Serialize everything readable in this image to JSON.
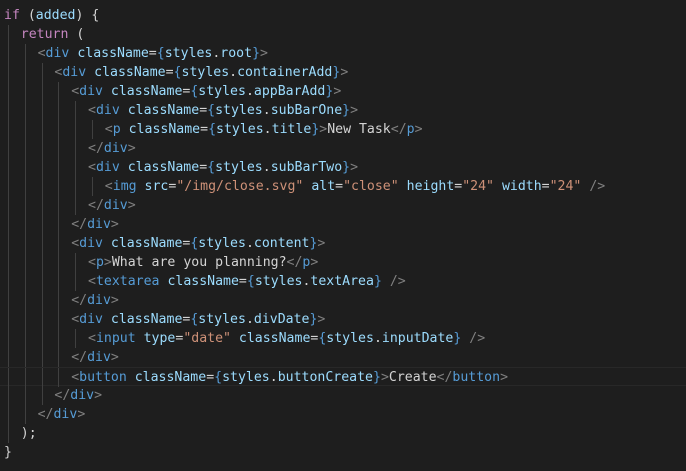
{
  "editor": {
    "language": "jsx",
    "theme": "dark",
    "cursor_line": 20,
    "lines": [
      {
        "indent": 0,
        "tokens": [
          [
            "kw",
            "if"
          ],
          [
            "punc",
            " ("
          ],
          [
            "var",
            "added"
          ],
          [
            "punc",
            ") {"
          ]
        ]
      },
      {
        "indent": 1,
        "tokens": [
          [
            "kw",
            "return"
          ],
          [
            "punc",
            " ("
          ]
        ]
      },
      {
        "indent": 2,
        "tokens": [
          [
            "ang",
            "<"
          ],
          [
            "tag",
            "div"
          ],
          [
            "txt",
            " "
          ],
          [
            "attr",
            "className"
          ],
          [
            "punc",
            "="
          ],
          [
            "brace",
            "{"
          ],
          [
            "var",
            "styles"
          ],
          [
            "punc",
            "."
          ],
          [
            "var",
            "root"
          ],
          [
            "brace",
            "}"
          ],
          [
            "ang",
            ">"
          ]
        ]
      },
      {
        "indent": 3,
        "tokens": [
          [
            "ang",
            "<"
          ],
          [
            "tag",
            "div"
          ],
          [
            "txt",
            " "
          ],
          [
            "attr",
            "className"
          ],
          [
            "punc",
            "="
          ],
          [
            "brace",
            "{"
          ],
          [
            "var",
            "styles"
          ],
          [
            "punc",
            "."
          ],
          [
            "var",
            "containerAdd"
          ],
          [
            "brace",
            "}"
          ],
          [
            "ang",
            ">"
          ]
        ]
      },
      {
        "indent": 4,
        "tokens": [
          [
            "ang",
            "<"
          ],
          [
            "tag",
            "div"
          ],
          [
            "txt",
            " "
          ],
          [
            "attr",
            "className"
          ],
          [
            "punc",
            "="
          ],
          [
            "brace",
            "{"
          ],
          [
            "var",
            "styles"
          ],
          [
            "punc",
            "."
          ],
          [
            "var",
            "appBarAdd"
          ],
          [
            "brace",
            "}"
          ],
          [
            "ang",
            ">"
          ]
        ]
      },
      {
        "indent": 5,
        "tokens": [
          [
            "ang",
            "<"
          ],
          [
            "tag",
            "div"
          ],
          [
            "txt",
            " "
          ],
          [
            "attr",
            "className"
          ],
          [
            "punc",
            "="
          ],
          [
            "brace",
            "{"
          ],
          [
            "var",
            "styles"
          ],
          [
            "punc",
            "."
          ],
          [
            "var",
            "subBarOne"
          ],
          [
            "brace",
            "}"
          ],
          [
            "ang",
            ">"
          ]
        ]
      },
      {
        "indent": 6,
        "tokens": [
          [
            "ang",
            "<"
          ],
          [
            "tag",
            "p"
          ],
          [
            "txt",
            " "
          ],
          [
            "attr",
            "className"
          ],
          [
            "punc",
            "="
          ],
          [
            "brace",
            "{"
          ],
          [
            "var",
            "styles"
          ],
          [
            "punc",
            "."
          ],
          [
            "var",
            "title"
          ],
          [
            "brace",
            "}"
          ],
          [
            "ang",
            ">"
          ],
          [
            "txt",
            "New Task"
          ],
          [
            "ang",
            "</"
          ],
          [
            "tag",
            "p"
          ],
          [
            "ang",
            ">"
          ]
        ]
      },
      {
        "indent": 5,
        "tokens": [
          [
            "ang",
            "</"
          ],
          [
            "tag",
            "div"
          ],
          [
            "ang",
            ">"
          ]
        ]
      },
      {
        "indent": 5,
        "tokens": [
          [
            "ang",
            "<"
          ],
          [
            "tag",
            "div"
          ],
          [
            "txt",
            " "
          ],
          [
            "attr",
            "className"
          ],
          [
            "punc",
            "="
          ],
          [
            "brace",
            "{"
          ],
          [
            "var",
            "styles"
          ],
          [
            "punc",
            "."
          ],
          [
            "var",
            "subBarTwo"
          ],
          [
            "brace",
            "}"
          ],
          [
            "ang",
            ">"
          ]
        ]
      },
      {
        "indent": 6,
        "tokens": [
          [
            "ang",
            "<"
          ],
          [
            "tag",
            "img"
          ],
          [
            "txt",
            " "
          ],
          [
            "attr",
            "src"
          ],
          [
            "punc",
            "="
          ],
          [
            "str",
            "\"/img/close.svg\""
          ],
          [
            "txt",
            " "
          ],
          [
            "attr",
            "alt"
          ],
          [
            "punc",
            "="
          ],
          [
            "str",
            "\"close\""
          ],
          [
            "txt",
            " "
          ],
          [
            "attr",
            "height"
          ],
          [
            "punc",
            "="
          ],
          [
            "str",
            "\"24\""
          ],
          [
            "txt",
            " "
          ],
          [
            "attr",
            "width"
          ],
          [
            "punc",
            "="
          ],
          [
            "str",
            "\"24\""
          ],
          [
            "txt",
            " "
          ],
          [
            "ang",
            "/>"
          ]
        ]
      },
      {
        "indent": 5,
        "tokens": [
          [
            "ang",
            "</"
          ],
          [
            "tag",
            "div"
          ],
          [
            "ang",
            ">"
          ]
        ]
      },
      {
        "indent": 4,
        "tokens": [
          [
            "ang",
            "</"
          ],
          [
            "tag",
            "div"
          ],
          [
            "ang",
            ">"
          ]
        ]
      },
      {
        "indent": 4,
        "tokens": [
          [
            "ang",
            "<"
          ],
          [
            "tag",
            "div"
          ],
          [
            "txt",
            " "
          ],
          [
            "attr",
            "className"
          ],
          [
            "punc",
            "="
          ],
          [
            "brace",
            "{"
          ],
          [
            "var",
            "styles"
          ],
          [
            "punc",
            "."
          ],
          [
            "var",
            "content"
          ],
          [
            "brace",
            "}"
          ],
          [
            "ang",
            ">"
          ]
        ]
      },
      {
        "indent": 5,
        "tokens": [
          [
            "ang",
            "<"
          ],
          [
            "tag",
            "p"
          ],
          [
            "ang",
            ">"
          ],
          [
            "txt",
            "What are you planning?"
          ],
          [
            "ang",
            "</"
          ],
          [
            "tag",
            "p"
          ],
          [
            "ang",
            ">"
          ]
        ]
      },
      {
        "indent": 5,
        "tokens": [
          [
            "ang",
            "<"
          ],
          [
            "tag",
            "textarea"
          ],
          [
            "txt",
            " "
          ],
          [
            "attr",
            "className"
          ],
          [
            "punc",
            "="
          ],
          [
            "brace",
            "{"
          ],
          [
            "var",
            "styles"
          ],
          [
            "punc",
            "."
          ],
          [
            "var",
            "textArea"
          ],
          [
            "brace",
            "}"
          ],
          [
            "txt",
            " "
          ],
          [
            "ang",
            "/>"
          ]
        ]
      },
      {
        "indent": 4,
        "tokens": [
          [
            "ang",
            "</"
          ],
          [
            "tag",
            "div"
          ],
          [
            "ang",
            ">"
          ]
        ]
      },
      {
        "indent": 4,
        "tokens": [
          [
            "ang",
            "<"
          ],
          [
            "tag",
            "div"
          ],
          [
            "txt",
            " "
          ],
          [
            "attr",
            "className"
          ],
          [
            "punc",
            "="
          ],
          [
            "brace",
            "{"
          ],
          [
            "var",
            "styles"
          ],
          [
            "punc",
            "."
          ],
          [
            "var",
            "divDate"
          ],
          [
            "brace",
            "}"
          ],
          [
            "ang",
            ">"
          ]
        ]
      },
      {
        "indent": 5,
        "tokens": [
          [
            "ang",
            "<"
          ],
          [
            "tag",
            "input"
          ],
          [
            "txt",
            " "
          ],
          [
            "attr",
            "type"
          ],
          [
            "punc",
            "="
          ],
          [
            "str",
            "\"date\""
          ],
          [
            "txt",
            " "
          ],
          [
            "attr",
            "className"
          ],
          [
            "punc",
            "="
          ],
          [
            "brace",
            "{"
          ],
          [
            "var",
            "styles"
          ],
          [
            "punc",
            "."
          ],
          [
            "var",
            "inputDate"
          ],
          [
            "brace",
            "}"
          ],
          [
            "txt",
            " "
          ],
          [
            "ang",
            "/>"
          ]
        ]
      },
      {
        "indent": 4,
        "tokens": [
          [
            "ang",
            "</"
          ],
          [
            "tag",
            "div"
          ],
          [
            "ang",
            ">"
          ]
        ]
      },
      {
        "indent": 4,
        "tokens": [
          [
            "ang",
            "<"
          ],
          [
            "tag",
            "button"
          ],
          [
            "txt",
            " "
          ],
          [
            "attr",
            "className"
          ],
          [
            "punc",
            "="
          ],
          [
            "brace",
            "{"
          ],
          [
            "var",
            "styles"
          ],
          [
            "punc",
            "."
          ],
          [
            "var",
            "buttonCreate"
          ],
          [
            "brace",
            "}"
          ],
          [
            "ang",
            ">"
          ],
          [
            "txt",
            "Create"
          ],
          [
            "ang",
            "</"
          ],
          [
            "tag",
            "button"
          ],
          [
            "ang",
            ">"
          ]
        ]
      },
      {
        "indent": 3,
        "tokens": [
          [
            "ang",
            "</"
          ],
          [
            "tag",
            "div"
          ],
          [
            "ang",
            ">"
          ]
        ]
      },
      {
        "indent": 2,
        "tokens": [
          [
            "ang",
            "</"
          ],
          [
            "tag",
            "div"
          ],
          [
            "ang",
            ">"
          ]
        ]
      },
      {
        "indent": 1,
        "tokens": [
          [
            "punc",
            ");"
          ]
        ]
      },
      {
        "indent": 0,
        "tokens": [
          [
            "punc",
            "}"
          ]
        ]
      }
    ]
  }
}
